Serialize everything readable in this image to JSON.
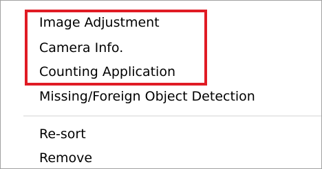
{
  "context_menu": {
    "items": [
      {
        "label": "Image Adjustment"
      },
      {
        "label": "Camera Info."
      },
      {
        "label": "Counting Application"
      },
      {
        "label": "Missing/Foreign Object Detection"
      }
    ],
    "secondary_items": [
      {
        "label": "Re-sort"
      },
      {
        "label": "Remove"
      }
    ]
  },
  "colors": {
    "highlight_border": "#e01b24",
    "menu_border": "#a0a0a0",
    "separator": "#d4d4d4",
    "background": "#ffffff"
  }
}
